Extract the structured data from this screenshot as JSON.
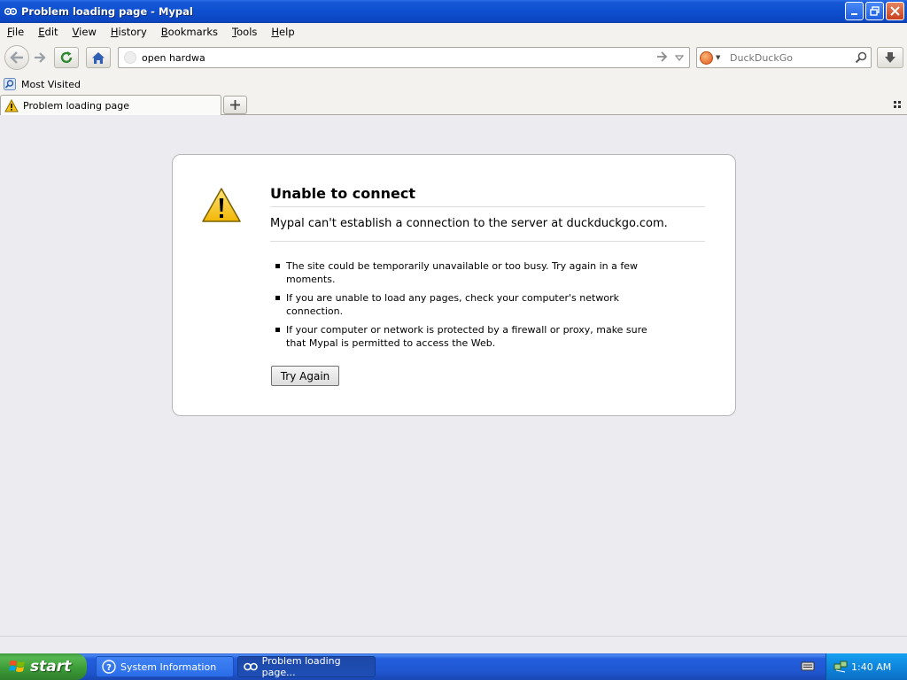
{
  "window": {
    "title": "Problem loading page - Mypal"
  },
  "menu": [
    "File",
    "Edit",
    "View",
    "History",
    "Bookmarks",
    "Tools",
    "Help"
  ],
  "menu_access_keys": [
    "F",
    "E",
    "V",
    "H",
    "B",
    "T",
    "H"
  ],
  "url": {
    "value": "open hardwa"
  },
  "search": {
    "engine": "DuckDuckGo",
    "placeholder": "DuckDuckGo"
  },
  "bookmarks": {
    "most_visited": "Most Visited"
  },
  "tab": {
    "label": "Problem loading page"
  },
  "error": {
    "title": "Unable to connect",
    "short": "Mypal can't establish a connection to the server at duckduckgo.com.",
    "items": [
      "The site could be temporarily unavailable or too busy. Try again in a few moments.",
      "If you are unable to load any pages, check your computer's network connection.",
      "If your computer or network is protected by a firewall or proxy, make sure that Mypal is permitted to access the Web."
    ],
    "button": "Try Again"
  },
  "taskbar": {
    "start": "start",
    "items": [
      {
        "label": "System Information"
      },
      {
        "label": "Problem loading page..."
      }
    ],
    "clock": "1:40 AM"
  },
  "colors": {
    "titlebar": "#0e4fd0",
    "taskbar": "#245edc",
    "start": "#3a9a36",
    "warning": "#f5c518"
  }
}
